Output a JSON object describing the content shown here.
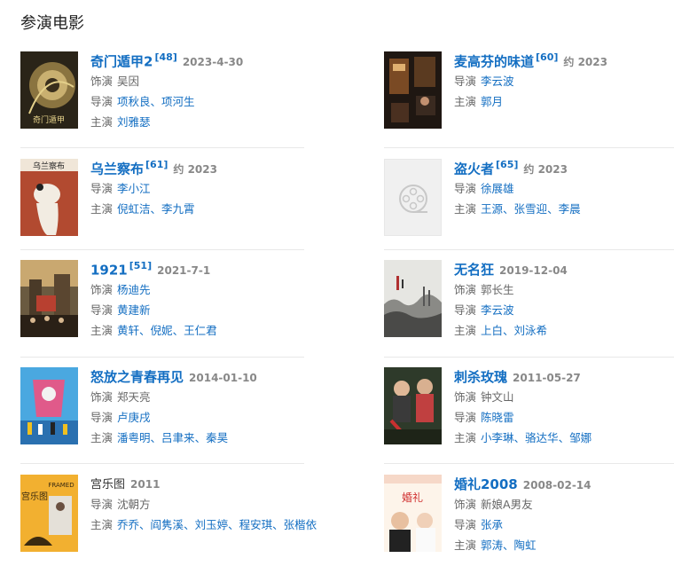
{
  "section_title": "参演电影",
  "labels": {
    "role": "饰演",
    "director": "导演",
    "cast": "主演",
    "sep": "、"
  },
  "movies": [
    {
      "title": "奇门遁甲2",
      "ref": "[48]",
      "date": "2023-4-30",
      "role": "吴因",
      "directors": [
        "项秋良",
        "项河生"
      ],
      "cast": [
        "刘雅瑟"
      ]
    },
    {
      "title": "麦高芬的味道",
      "ref": "[60]",
      "date": "约 2023",
      "directors": [
        "李云波"
      ],
      "cast": [
        "郭月"
      ]
    },
    {
      "title": "乌兰察布",
      "ref": "[61]",
      "date": "约 2023",
      "directors": [
        "李小江"
      ],
      "cast": [
        "倪虹洁",
        "李九霄"
      ]
    },
    {
      "title": "盗火者",
      "ref": "[65]",
      "date": "约 2023",
      "directors": [
        "徐展雄"
      ],
      "cast": [
        "王源",
        "张雪迎",
        "李晨"
      ]
    },
    {
      "title": "1921",
      "ref": "[51]",
      "date": "2021-7-1",
      "role": "杨迪先",
      "directors": [
        "黄建新"
      ],
      "cast": [
        "黄轩",
        "倪妮",
        "王仁君"
      ]
    },
    {
      "title": "无名狂",
      "ref": "",
      "date": "2019-12-04",
      "role": "郭长生",
      "directors": [
        "李云波"
      ],
      "cast": [
        "上白",
        "刘泳希"
      ]
    },
    {
      "title": "怒放之青春再见",
      "ref": "",
      "date": "2014-01-10",
      "role": "郑天亮",
      "directors": [
        "卢庚戌"
      ],
      "cast": [
        "潘粤明",
        "吕聿来",
        "秦昊"
      ]
    },
    {
      "title": "刺杀玫瑰",
      "ref": "",
      "date": "2011-05-27",
      "role": "钟文山",
      "directors": [
        "陈晓雷"
      ],
      "cast": [
        "小李琳",
        "骆达华",
        "邹娜"
      ]
    },
    {
      "title": "宫乐图",
      "ref": "",
      "date": "2011",
      "directors_plain": "沈朝方",
      "cast": [
        "乔乔",
        "阎隽溪",
        "刘玉婷",
        "程安琪",
        "张楷依"
      ]
    },
    {
      "title": "婚礼2008",
      "ref": "",
      "date": "2008-02-14",
      "role": "新娘A男友",
      "directors": [
        "张承"
      ],
      "cast": [
        "郭涛",
        "陶虹"
      ]
    }
  ],
  "poster_texts": {
    "p1": "奇门遁甲",
    "p3": "乌兰察布",
    "p9_a": "宫乐图",
    "p9_b": "FRAMED",
    "p10": "婚礼"
  },
  "colors": {
    "link": "#136ec2",
    "muted": "#666666",
    "divider": "#e8e8e8"
  },
  "icons": {
    "placeholder": "film-reel-icon"
  }
}
